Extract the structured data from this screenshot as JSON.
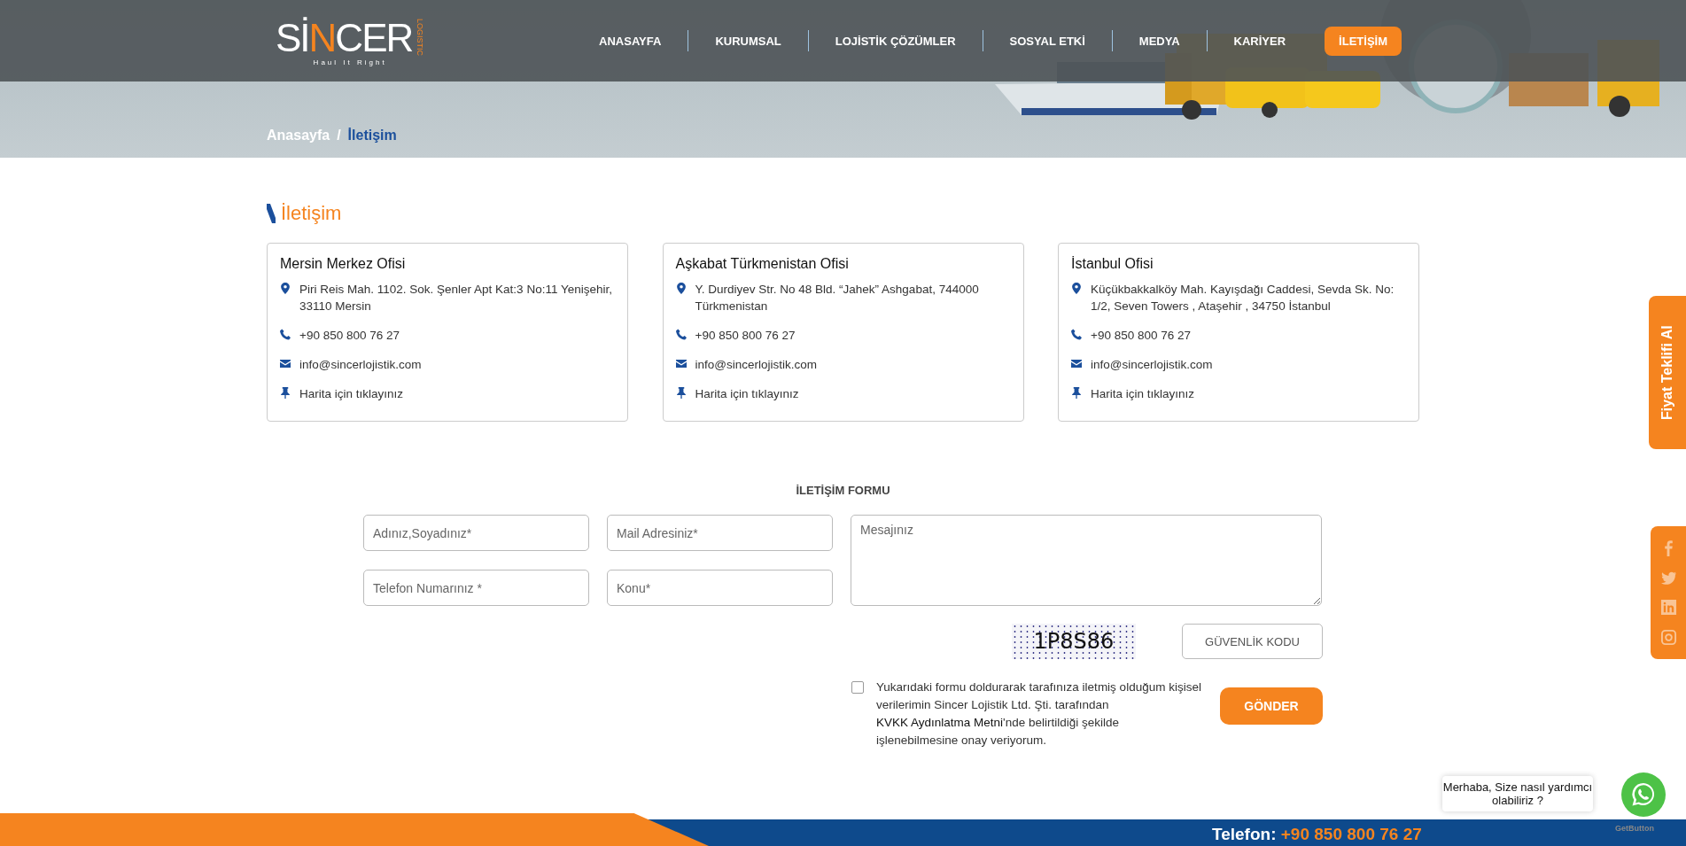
{
  "logo": {
    "wordmark": [
      "Sİ",
      "N",
      "CER"
    ],
    "side_text": "LOGISTIC",
    "tagline": "Haul It Right"
  },
  "nav": [
    {
      "label": "ANASAYFA",
      "selected": false
    },
    {
      "label": "KURUMSAL",
      "selected": false
    },
    {
      "label": "LOJİSTİK ÇÖZÜMLER",
      "selected": false
    },
    {
      "label": "SOSYAL ETKİ",
      "selected": false
    },
    {
      "label": "MEDYA",
      "selected": false
    },
    {
      "label": "KARİYER",
      "selected": false
    },
    {
      "label": "İLETİŞİM",
      "selected": true
    }
  ],
  "breadcrumb": [
    {
      "label": "Anasayfa",
      "selected": false
    },
    {
      "label": "İletişim",
      "selected": true
    }
  ],
  "breadcrumb_separator": "/",
  "section_title": "İletişim",
  "offices": [
    {
      "title": "Mersin Merkez Ofisi",
      "address": "Piri Reis Mah. 1102. Sok. Şenler Apt Kat:3 No:11 Yenişehir, 33110 Mersin",
      "phone": "+90 850 800 76 27",
      "email": "info@sincerlojistik.com",
      "map_link": "Harita için tıklayınız"
    },
    {
      "title": "Aşkabat Türkmenistan Ofisi",
      "address": "Y. Durdiyev Str. No 48 Bld. “Jahek” Ashgabat, 744000 Türkmenistan",
      "phone": "+90 850 800 76 27",
      "email": "info@sincerlojistik.com",
      "map_link": "Harita için tıklayınız"
    },
    {
      "title": "İstanbul Ofisi",
      "address": "Küçükbakkalköy Mah. Kayışdağı Caddesi, Sevda Sk. No: 1/2, Seven Towers , Ataşehir , 34750 İstanbul",
      "phone": "+90 850 800 76 27",
      "email": "info@sincerlojistik.com",
      "map_link": "Harita için tıklayınız"
    }
  ],
  "form": {
    "title": "İLETİŞİM FORMU",
    "fields": [
      {
        "placeholder": "Adınız,Soyadınız*"
      },
      {
        "placeholder": "Mail Adresiniz*"
      },
      {
        "placeholder": "Telefon Numarınız *"
      },
      {
        "placeholder": "Konu*"
      }
    ],
    "message": {
      "placeholder": "Mesajınız"
    },
    "captcha": "1P8S86",
    "security_code": {
      "placeholder": "GÜVENLİK KODU"
    },
    "consent": {
      "checked": false,
      "text_before": "Yukarıdaki formu doldurarak tarafınıza iletmiş olduğum kişisel verilerimin Sincer Lojistik Ltd. Şti. tarafından",
      "link": "KVKK Aydınlatma Metni",
      "text_after": "'nde belirtildiği şekilde işlenebilmesine onay veriyorum."
    },
    "submit": "GÖNDER"
  },
  "quote_tab": "Fiyat Teklifi Al",
  "social": [
    {
      "kind": "facebook"
    },
    {
      "kind": "twitter"
    },
    {
      "kind": "linkedin"
    },
    {
      "kind": "instagram"
    }
  ],
  "chat": {
    "bubble": "Merhaba, Size nasıl yardımcı olabiliriz ?",
    "brand": "GetButton"
  },
  "footer": {
    "label": "Telefon:",
    "phone": "+90 850 800 76 27"
  }
}
